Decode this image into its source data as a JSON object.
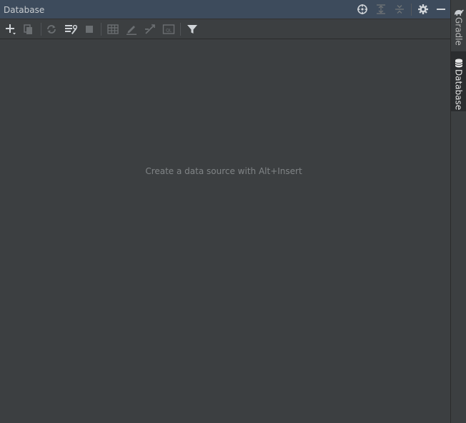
{
  "titlebar": {
    "title": "Database",
    "icons": [
      "locate-icon",
      "expand-all-icon",
      "collapse-all-icon",
      "gear-icon",
      "minimize-icon"
    ]
  },
  "toolbar": {
    "icons": [
      "add-icon",
      "duplicate-icon",
      "refresh-icon",
      "properties-icon",
      "stop-icon",
      "table-icon",
      "edit-icon",
      "jump-to-icon",
      "console-icon",
      "filter-icon"
    ]
  },
  "content": {
    "empty_message": "Create a data source with Alt+Insert"
  },
  "stripe": {
    "tabs": [
      {
        "label": "Gradle",
        "icon": "gradle-icon",
        "active": false
      },
      {
        "label": "Database",
        "icon": "database-icon",
        "active": true
      }
    ]
  },
  "colors": {
    "titlebar_bg": "#3d4b5c",
    "panel_bg": "#3c3f41",
    "text_muted": "#808486"
  }
}
